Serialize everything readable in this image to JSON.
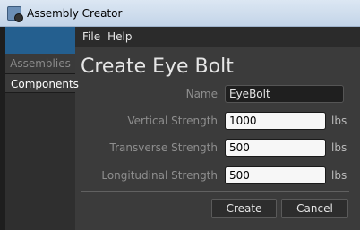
{
  "window": {
    "title": "Assembly Creator",
    "icon": "app-icon"
  },
  "menu": {
    "items": [
      "File",
      "Help"
    ]
  },
  "tabs": {
    "assemblies": "Assemblies",
    "components": "Components"
  },
  "form": {
    "heading": "Create Eye Bolt",
    "name": {
      "label": "Name",
      "value": "EyeBolt"
    },
    "vertical": {
      "label": "Vertical Strength",
      "value": "1000",
      "unit": "lbs"
    },
    "transverse": {
      "label": "Transverse Strength",
      "value": "500",
      "unit": "lbs"
    },
    "longitudinal": {
      "label": "Longitudinal Strength",
      "value": "500",
      "unit": "lbs"
    }
  },
  "buttons": {
    "create": "Create",
    "cancel": "Cancel"
  },
  "colors": {
    "accent": "#245f8f",
    "background": "#3b3b3b"
  }
}
